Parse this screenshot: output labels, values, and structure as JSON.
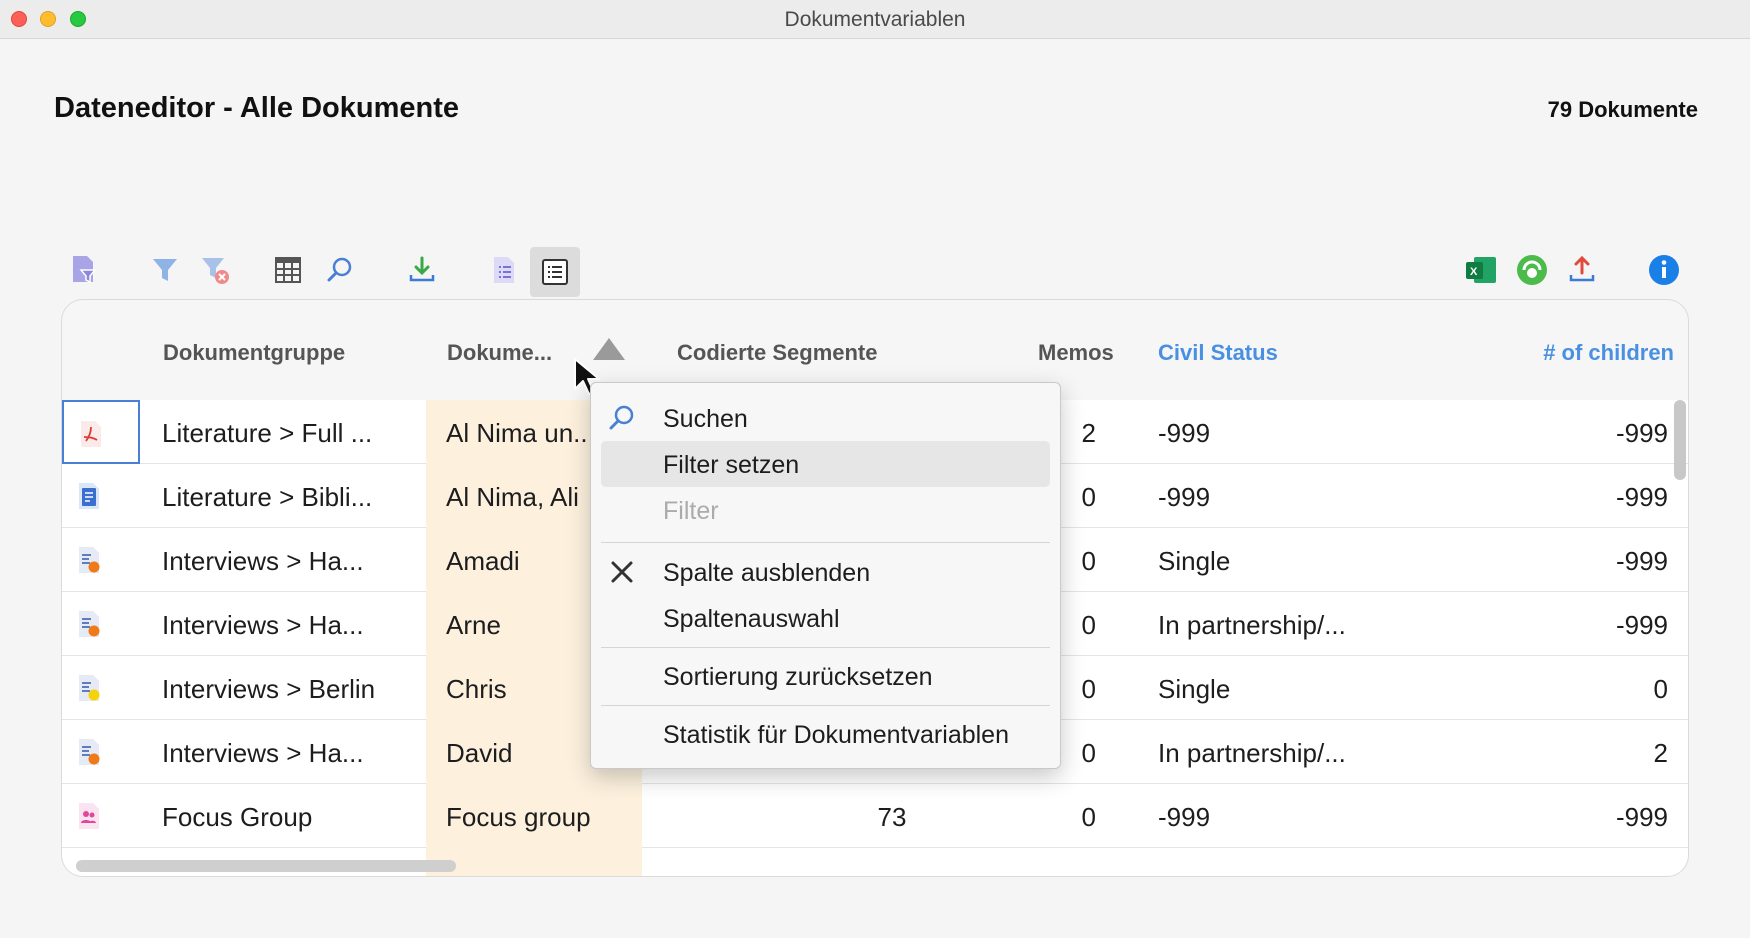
{
  "window": {
    "title": "Dokumentvariablen"
  },
  "header": {
    "title": "Dateneditor - Alle Dokumente",
    "count": "79 Dokumente"
  },
  "toolbar": {
    "left_icons": [
      "document-filter-icon",
      "filter-icon",
      "clear-filter-icon",
      "columns-icon",
      "search-icon",
      "import-icon",
      "list-view-icon",
      "detail-view-icon"
    ],
    "right_icons": [
      "excel-export-icon",
      "spss-export-icon",
      "export-icon",
      "info-icon"
    ]
  },
  "table": {
    "columns": [
      "Dokumentgruppe",
      "Dokume...",
      "Codierte Segmente",
      "Memos",
      "Civil Status",
      "# of children"
    ],
    "sort_column": "Dokume...",
    "rows": [
      {
        "icon": "pdf-icon",
        "group": "Literature > Full ...",
        "name": "Al Nima un...",
        "segments": "",
        "memos": "2",
        "civil": "-999",
        "children": "-999"
      },
      {
        "icon": "text-document-icon",
        "group": "Literature > Bibli...",
        "name": "Al Nima, Ali",
        "segments": "",
        "memos": "0",
        "civil": "-999",
        "children": "-999"
      },
      {
        "icon": "interview-orange-icon",
        "group": "Interviews > Ha...",
        "name": "Amadi",
        "segments": "",
        "memos": "0",
        "civil": "Single",
        "children": "-999"
      },
      {
        "icon": "interview-orange-icon",
        "group": "Interviews > Ha...",
        "name": "Arne",
        "segments": "",
        "memos": "0",
        "civil": "In partnership/...",
        "children": "-999"
      },
      {
        "icon": "interview-yellow-icon",
        "group": "Interviews > Berlin",
        "name": "Chris",
        "segments": "",
        "memos": "0",
        "civil": "Single",
        "children": "0"
      },
      {
        "icon": "interview-orange-icon",
        "group": "Interviews > Ha...",
        "name": "David",
        "segments": "",
        "memos": "0",
        "civil": "In partnership/...",
        "children": "2"
      },
      {
        "icon": "focus-group-icon",
        "group": "Focus Group",
        "name": "Focus group",
        "segments": "73",
        "memos": "0",
        "civil": "-999",
        "children": "-999"
      }
    ]
  },
  "context_menu": {
    "items": [
      {
        "label": "Suchen",
        "icon": "search-icon"
      },
      {
        "label": "Filter setzen"
      },
      {
        "label": "Filter",
        "disabled": true
      },
      {
        "label": "Spalte ausblenden",
        "icon": "close-icon"
      },
      {
        "label": "Spaltenauswahl"
      },
      {
        "label": "Sortierung zurücksetzen"
      },
      {
        "label": "Statistik für Dokumentvariablen"
      }
    ]
  }
}
